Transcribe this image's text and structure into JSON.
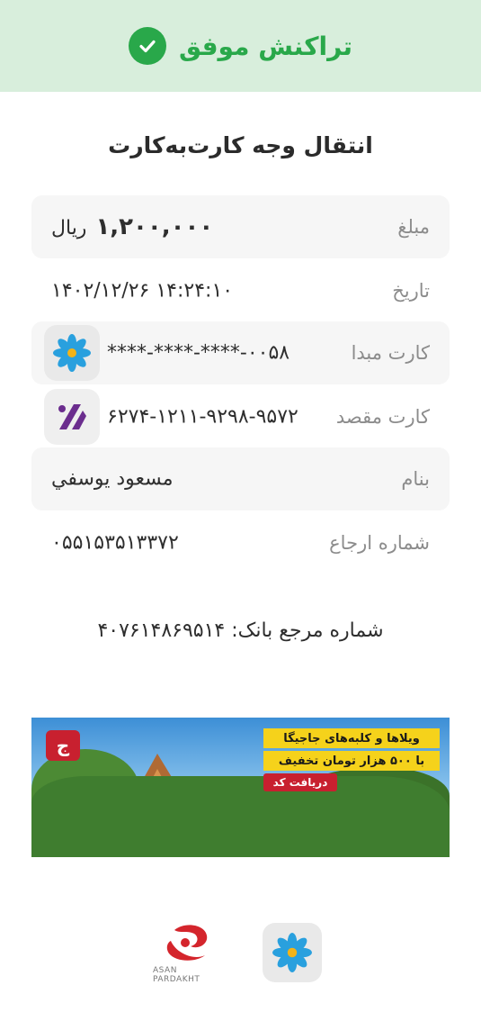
{
  "header": {
    "status_title": "تراکنش موفق",
    "accent": "#29a84a",
    "background": "#d8eedc"
  },
  "page_title": "انتقال وجه کارت‌به‌کارت",
  "rows": {
    "amount": {
      "label": "مبلغ",
      "value": "۱,۲۰۰,۰۰۰",
      "unit": "ریال"
    },
    "date": {
      "label": "تاریخ",
      "value": "۱۴:۲۴:۱۰ ۱۴۰۲/۱۲/۲۶"
    },
    "source_card": {
      "label": "کارت مبدا",
      "value": "****-****-****-۰۰۵۸",
      "bank_icon": "blue-flower-bank-logo"
    },
    "dest_card": {
      "label": "کارت مقصد",
      "value": "۶۲۷۴-۱۲۱۱-۹۲۹۸-۹۵۷۲",
      "bank_icon": "purple-bank-logo"
    },
    "name": {
      "label": "بنام",
      "value": "مسعود يوسفي"
    },
    "reference": {
      "label": "شماره ارجاع",
      "value": "۰۵۵۱۵۳۵۱۳۳۷۲"
    }
  },
  "bank_reference": "شماره مرجع بانک: ۴۰۷۶۱۴۸۶۹۵۱۴",
  "banner": {
    "line1": "ویلاها و کلبه‌های جاجیگا",
    "line2": "با ۵۰۰ هزار تومان تخفیف",
    "cta": "دریافت کد",
    "logo_text": "ج"
  },
  "footer": {
    "asan_caption": "ASAN PARDAKHT"
  }
}
